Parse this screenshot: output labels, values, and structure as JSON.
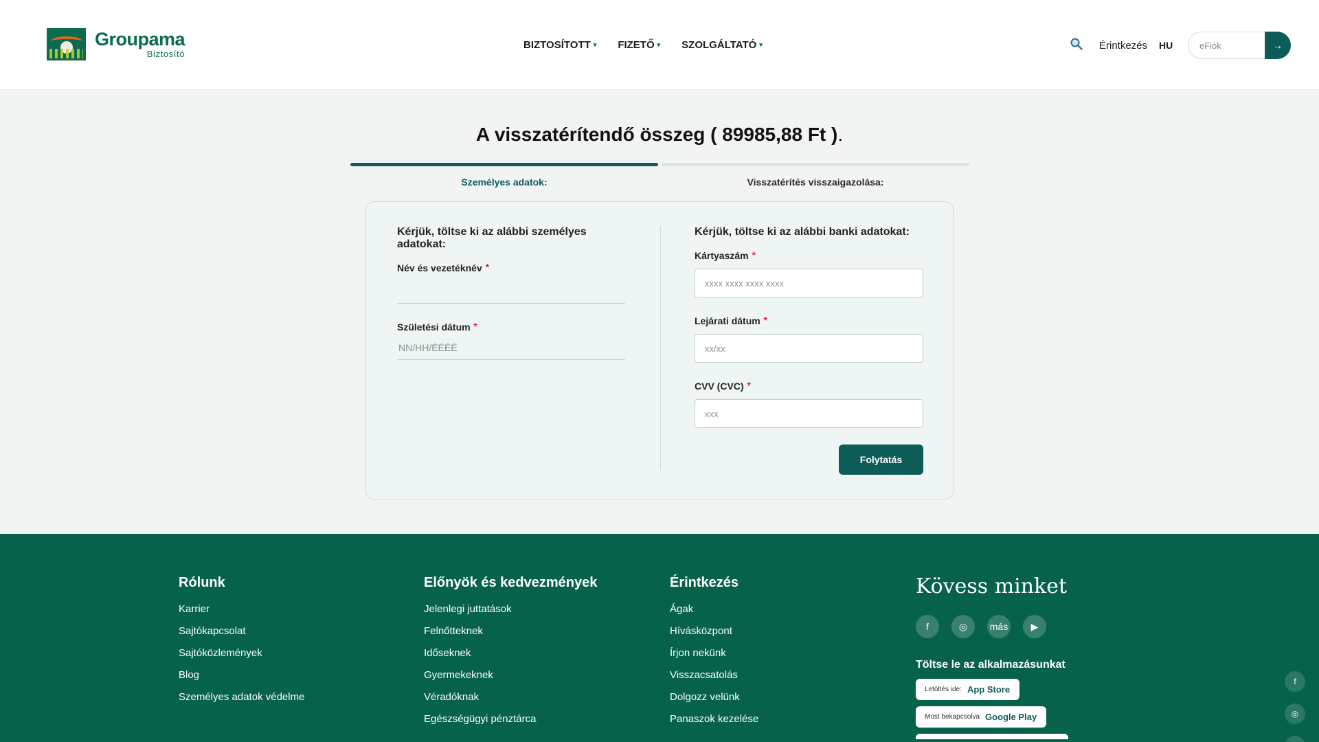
{
  "header": {
    "logo_name": "Groupama",
    "logo_sub": "Biztosító",
    "nav": [
      {
        "label": "BIZTOSÍTOTT",
        "caret": "▾"
      },
      {
        "label": "FIZETŐ",
        "caret": "▾"
      },
      {
        "label": "SZOLGÁLTATÓ",
        "caret": "▾"
      }
    ],
    "contact_label": "Érintkezés",
    "lang": "HU",
    "account_placeholder": "eFiók",
    "account_button": "→"
  },
  "main": {
    "title": "A visszatérítendő összeg ( 89985,88 Ft )",
    "title_end": ".",
    "progress_fraction": 0.5,
    "steps": [
      "Személyes adatok:",
      "Visszatérítés visszaigazolása:"
    ],
    "left_section": {
      "title": "Kérjük, töltse ki az alábbi személyes adatokat:",
      "name_label": "Név és vezetéknév",
      "name_value": "",
      "dob_label": "Születési dátum",
      "dob_placeholder": "NN/HH/ÉÉÉÉ"
    },
    "right_section": {
      "title": "Kérjük, töltse ki az alábbi banki adatokat:",
      "card_label": "Kártyaszám",
      "card_placeholder": "xxxx xxxx xxxx xxxx",
      "expiry_label": "Lejárati dátum",
      "expiry_placeholder": "xx/xx",
      "cvv_label": "CVV (CVC)",
      "cvv_placeholder": "xxx"
    },
    "required_mark": "*",
    "continue_label": "Folytatás"
  },
  "footer": {
    "columns": [
      {
        "title": "Rólunk",
        "links": [
          "Karrier",
          "Sajtókapcsolat",
          "Sajtóközlemények",
          "Blog",
          "Személyes adatok védelme"
        ]
      },
      {
        "title": "Előnyök és kedvezmények",
        "links": [
          "Jelenlegi juttatások",
          "Felnőtteknek",
          "Időseknek",
          "Gyermekeknek",
          "Véradóknak",
          "Egészségügyi pénztárca"
        ]
      },
      {
        "title": "Érintkezés",
        "links": [
          "Ágak",
          "Hívásközpont",
          "Írjon nekünk",
          "Visszacsatolás",
          "Dolgozz velünk",
          "Panaszok kezelése"
        ]
      }
    ],
    "follow_title": "Kövess minket",
    "social": [
      {
        "icon": "facebook-icon",
        "glyph": "f"
      },
      {
        "icon": "instagram-icon",
        "glyph": "◎"
      },
      {
        "icon": "more-icon",
        "glyph": "más"
      },
      {
        "icon": "youtube-icon",
        "glyph": "▶"
      }
    ],
    "app_title": "Töltse le az alkalmazásunkat",
    "app_store": {
      "small": "Letöltés ide:",
      "big": "App Store"
    },
    "google_play": {
      "small": "Most bekapcsolva",
      "big": "Google Play"
    },
    "floating": [
      {
        "icon": "facebook-icon",
        "glyph": "f"
      },
      {
        "icon": "instagram-icon",
        "glyph": "◎"
      }
    ]
  },
  "colors": {
    "brand_green": "#07624c",
    "accent_teal": "#0e5c58",
    "required_red": "#d0021b"
  }
}
